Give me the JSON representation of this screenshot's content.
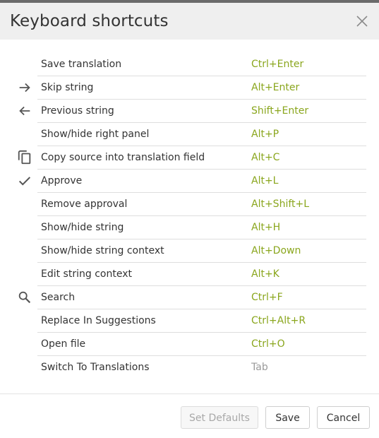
{
  "dialog": {
    "title": "Keyboard shortcuts",
    "close_icon": "close-icon"
  },
  "shortcuts": [
    {
      "label": "Save translation",
      "key": "Ctrl+Enter",
      "icon": ""
    },
    {
      "label": "Skip string",
      "key": "Alt+Enter",
      "icon": "arrow-right-icon"
    },
    {
      "label": "Previous string",
      "key": "Shift+Enter",
      "icon": "arrow-left-icon"
    },
    {
      "label": "Show/hide right panel",
      "key": "Alt+P",
      "icon": ""
    },
    {
      "label": "Copy source into translation field",
      "key": "Alt+C",
      "icon": "copy-icon"
    },
    {
      "label": "Approve",
      "key": "Alt+L",
      "icon": "checkmark-icon"
    },
    {
      "label": "Remove approval",
      "key": "Alt+Shift+L",
      "icon": ""
    },
    {
      "label": "Show/hide string",
      "key": "Alt+H",
      "icon": ""
    },
    {
      "label": "Show/hide string context",
      "key": "Alt+Down",
      "icon": ""
    },
    {
      "label": "Edit string context",
      "key": "Alt+K",
      "icon": ""
    },
    {
      "label": "Search",
      "key": "Ctrl+F",
      "icon": "search-icon"
    },
    {
      "label": "Replace In Suggestions",
      "key": "Ctrl+Alt+R",
      "icon": ""
    },
    {
      "label": "Open file",
      "key": "Ctrl+O",
      "icon": ""
    },
    {
      "label": "Switch To Translations",
      "key": "Tab",
      "icon": ""
    }
  ],
  "footer": {
    "set_defaults_label": "Set Defaults",
    "save_label": "Save",
    "cancel_label": "Cancel"
  },
  "colors": {
    "shortcut_key": "#8aa61d",
    "shortcut_key_muted": "#9a9a9a",
    "header_bg": "#efefef"
  }
}
